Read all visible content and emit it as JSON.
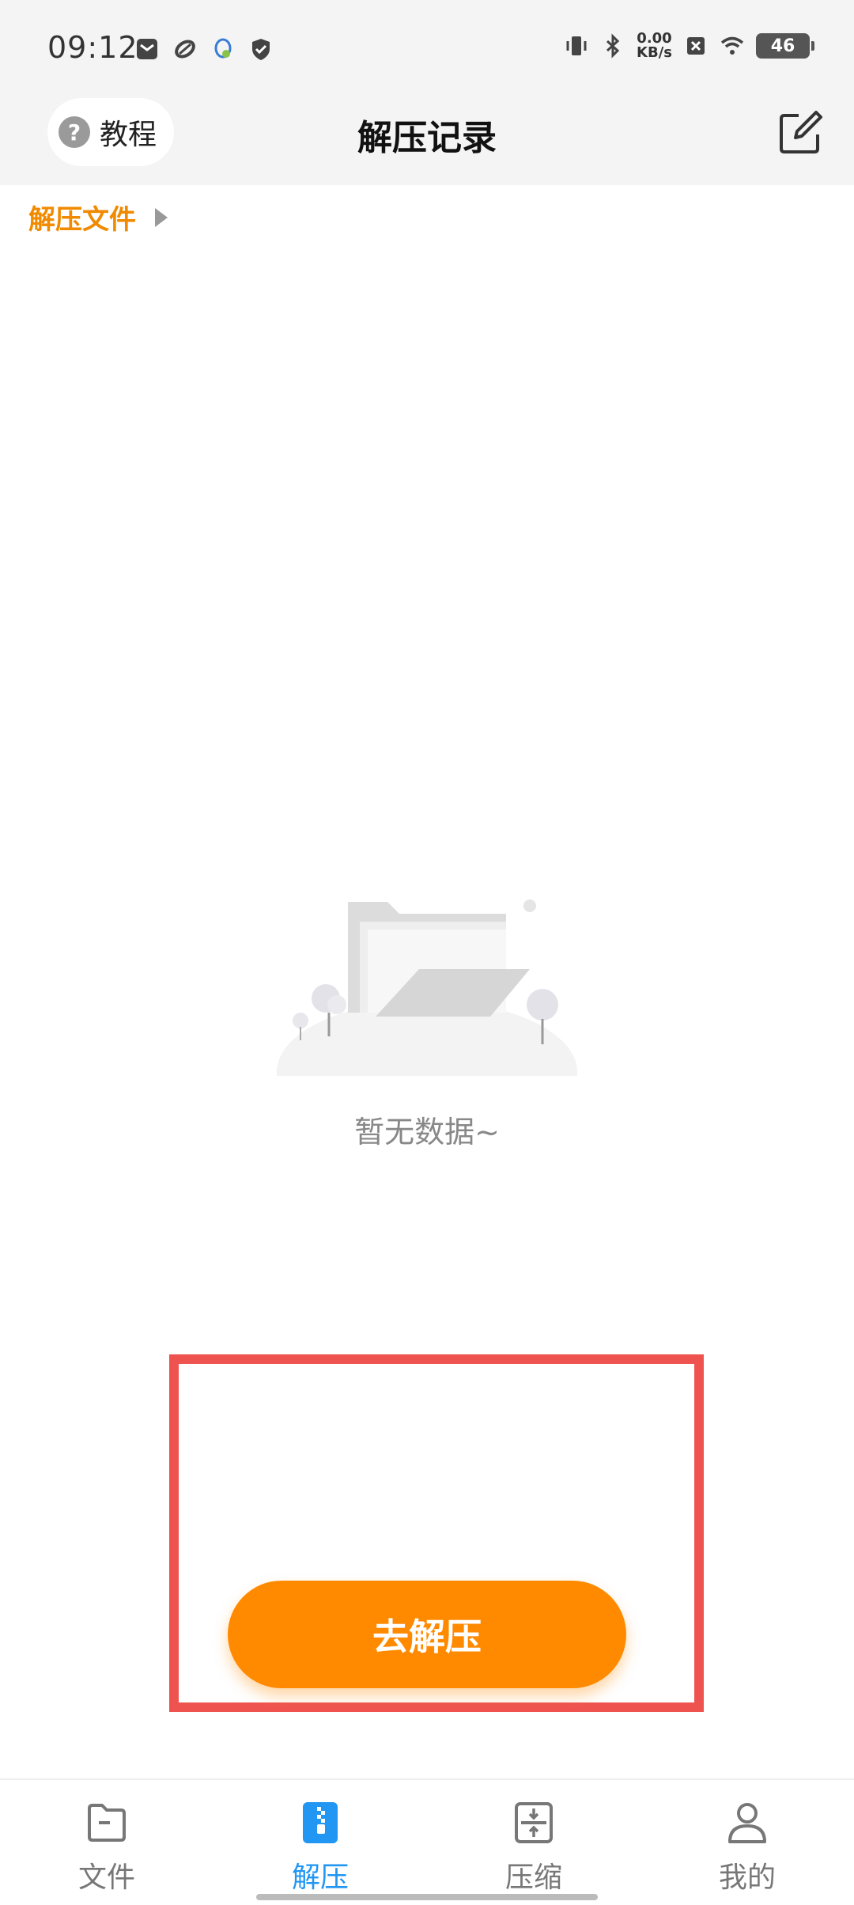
{
  "status_bar": {
    "time": "09:12",
    "net_speed_value": "0.00",
    "net_speed_unit": "KB/s",
    "battery": "46",
    "left_icons": [
      "mail-icon",
      "link-icon",
      "qq-icon",
      "shield-icon"
    ],
    "right_icons": [
      "vibrate-icon",
      "bluetooth-icon",
      "no-sim-icon",
      "wifi-icon",
      "battery-icon"
    ]
  },
  "header": {
    "tutorial_label": "教程",
    "title": "解压记录",
    "edit_icon": "edit-icon"
  },
  "breadcrumb": {
    "label": "解压文件"
  },
  "empty_state": {
    "text": "暂无数据~",
    "illustration": "empty-folder-illustration"
  },
  "primary_action": {
    "label": "去解压"
  },
  "colors": {
    "accent": "#ff8a00",
    "active_tab": "#2196f3",
    "highlight_border": "#ef5350"
  },
  "bottom_nav": {
    "items": [
      {
        "label": "文件",
        "icon": "folder-icon",
        "active": false
      },
      {
        "label": "解压",
        "icon": "zip-icon",
        "active": true
      },
      {
        "label": "压缩",
        "icon": "compress-icon",
        "active": false
      },
      {
        "label": "我的",
        "icon": "person-icon",
        "active": false
      }
    ]
  }
}
